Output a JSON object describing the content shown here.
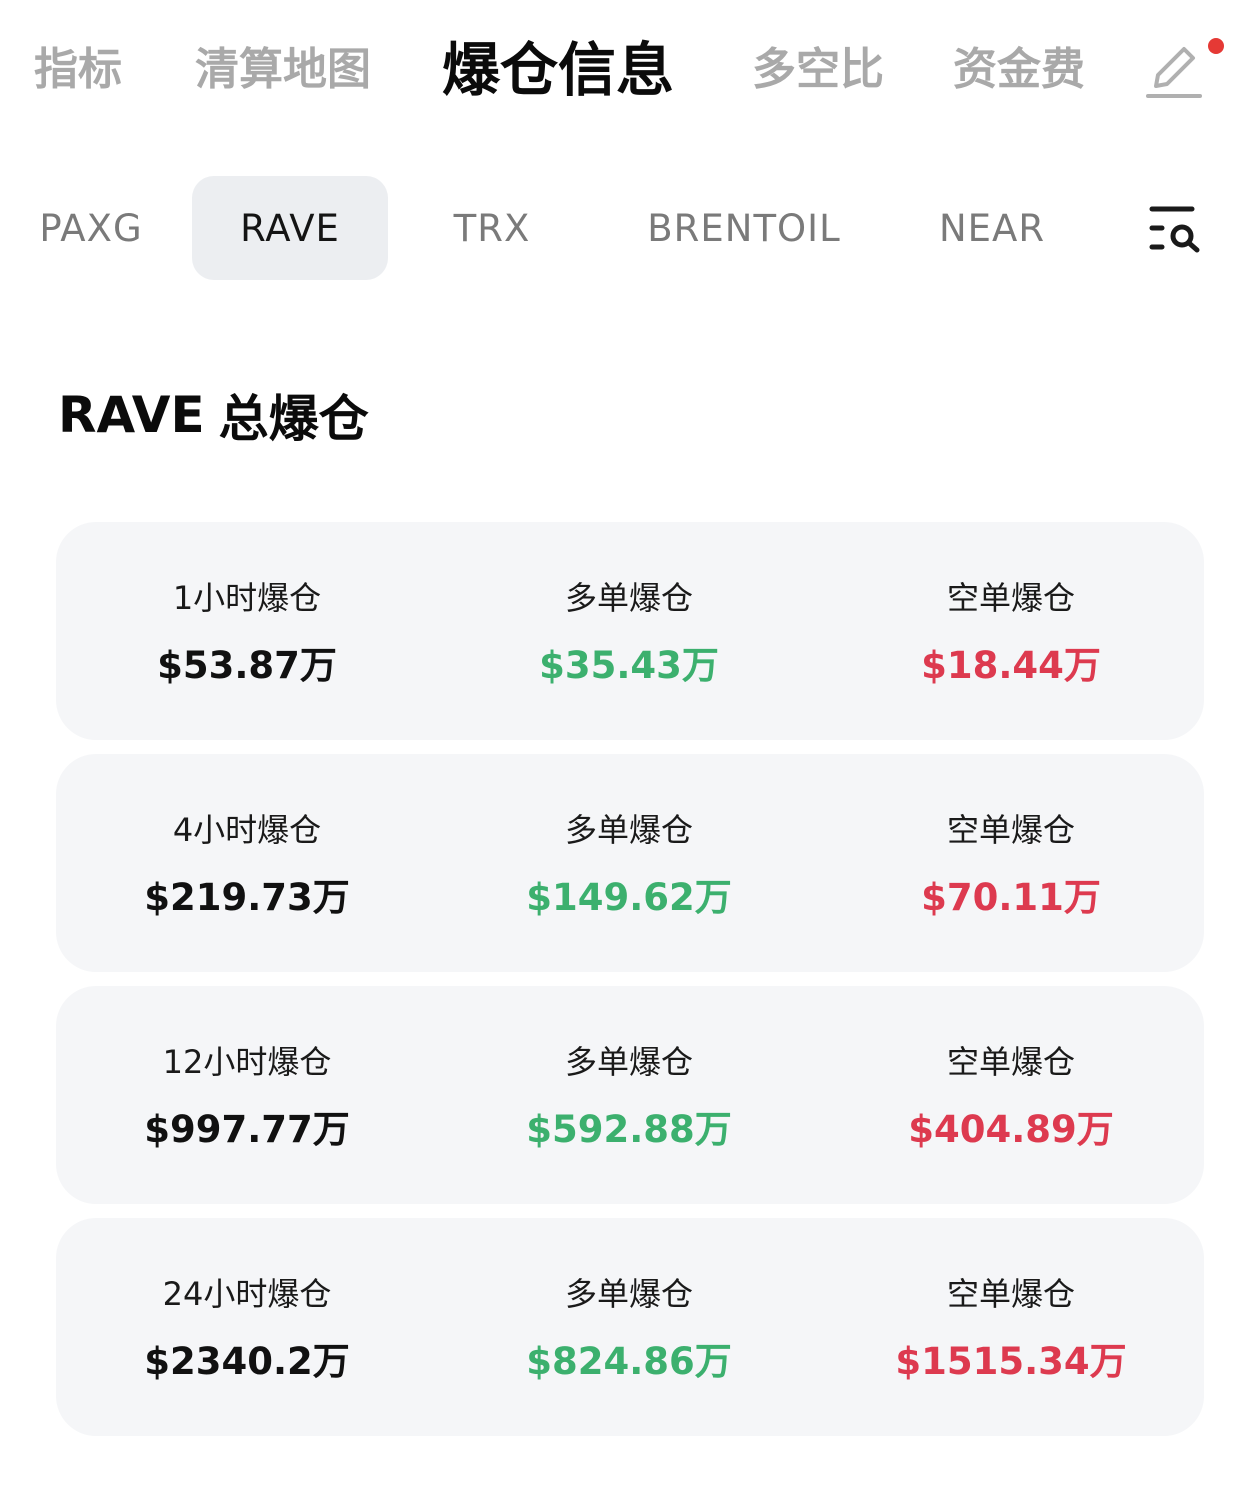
{
  "colors": {
    "long": "#3cb06e",
    "short": "#dd3a4f",
    "dot": "#e53935",
    "active_bg": "#eceef1"
  },
  "top_tabs": [
    {
      "label": "指标",
      "active": false
    },
    {
      "label": "清算地图",
      "active": false
    },
    {
      "label": "爆仓信息",
      "active": true
    },
    {
      "label": "多空比",
      "active": false
    },
    {
      "label": "资金费",
      "active": false
    }
  ],
  "icons": {
    "edit": "pencil-edit-icon",
    "filter": "list-search-icon"
  },
  "symbol_tabs": [
    {
      "label": "PAXG",
      "active": false
    },
    {
      "label": "RAVE",
      "active": true
    },
    {
      "label": "TRX",
      "active": false
    },
    {
      "label": "BRENTOIL",
      "active": false
    },
    {
      "label": "NEAR",
      "active": false
    }
  ],
  "section": {
    "symbol": "RAVE",
    "title": "总爆仓"
  },
  "cards": [
    {
      "total_label": "1小时爆仓",
      "total": "$53.87万",
      "long_label": "多单爆仓",
      "long": "$35.43万",
      "short_label": "空单爆仓",
      "short": "$18.44万"
    },
    {
      "total_label": "4小时爆仓",
      "total": "$219.73万",
      "long_label": "多单爆仓",
      "long": "$149.62万",
      "short_label": "空单爆仓",
      "short": "$70.11万"
    },
    {
      "total_label": "12小时爆仓",
      "total": "$997.77万",
      "long_label": "多单爆仓",
      "long": "$592.88万",
      "short_label": "空单爆仓",
      "short": "$404.89万"
    },
    {
      "total_label": "24小时爆仓",
      "total": "$2340.2万",
      "long_label": "多单爆仓",
      "long": "$824.86万",
      "short_label": "空单爆仓",
      "short": "$1515.34万"
    }
  ]
}
